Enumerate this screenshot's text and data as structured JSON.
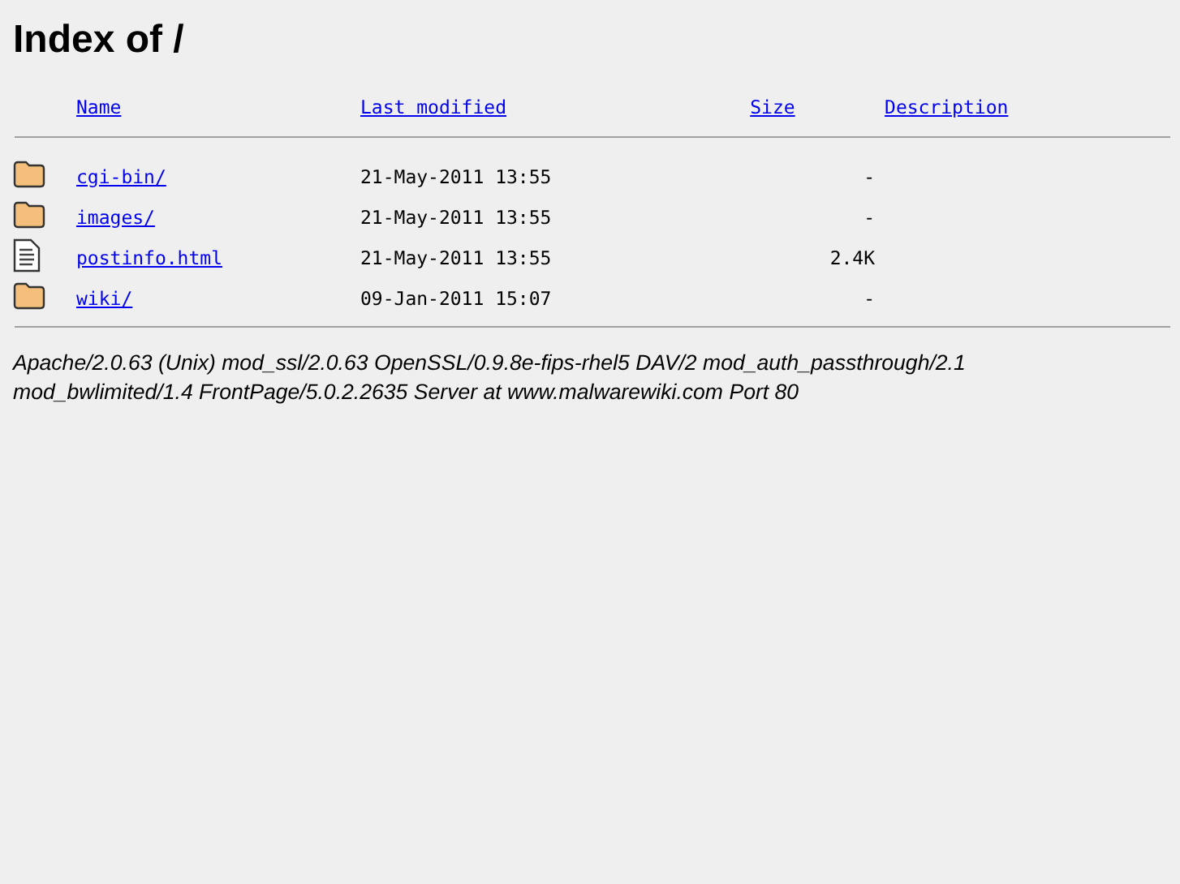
{
  "title": "Index of /",
  "columns": [
    "Name",
    "Last modified",
    "Size",
    "Description"
  ],
  "rows": [
    {
      "kind": "folder",
      "name": "cgi-bin/",
      "modified": "21-May-2011 13:55",
      "size": "-"
    },
    {
      "kind": "folder",
      "name": "images/",
      "modified": "21-May-2011 13:55",
      "size": "-"
    },
    {
      "kind": "file",
      "name": "postinfo.html",
      "modified": "21-May-2011 13:55",
      "size": "2.4K"
    },
    {
      "kind": "folder",
      "name": "wiki/",
      "modified": "09-Jan-2011 15:07",
      "size": "-"
    }
  ],
  "address": "Apache/2.0.63 (Unix) mod_ssl/2.0.63 OpenSSL/0.9.8e-fips-rhel5 DAV/2 mod_auth_passthrough/2.1 mod_bwlimited/1.4 FrontPage/5.0.2.2635 Server at www.malwarewiki.com Port 80"
}
